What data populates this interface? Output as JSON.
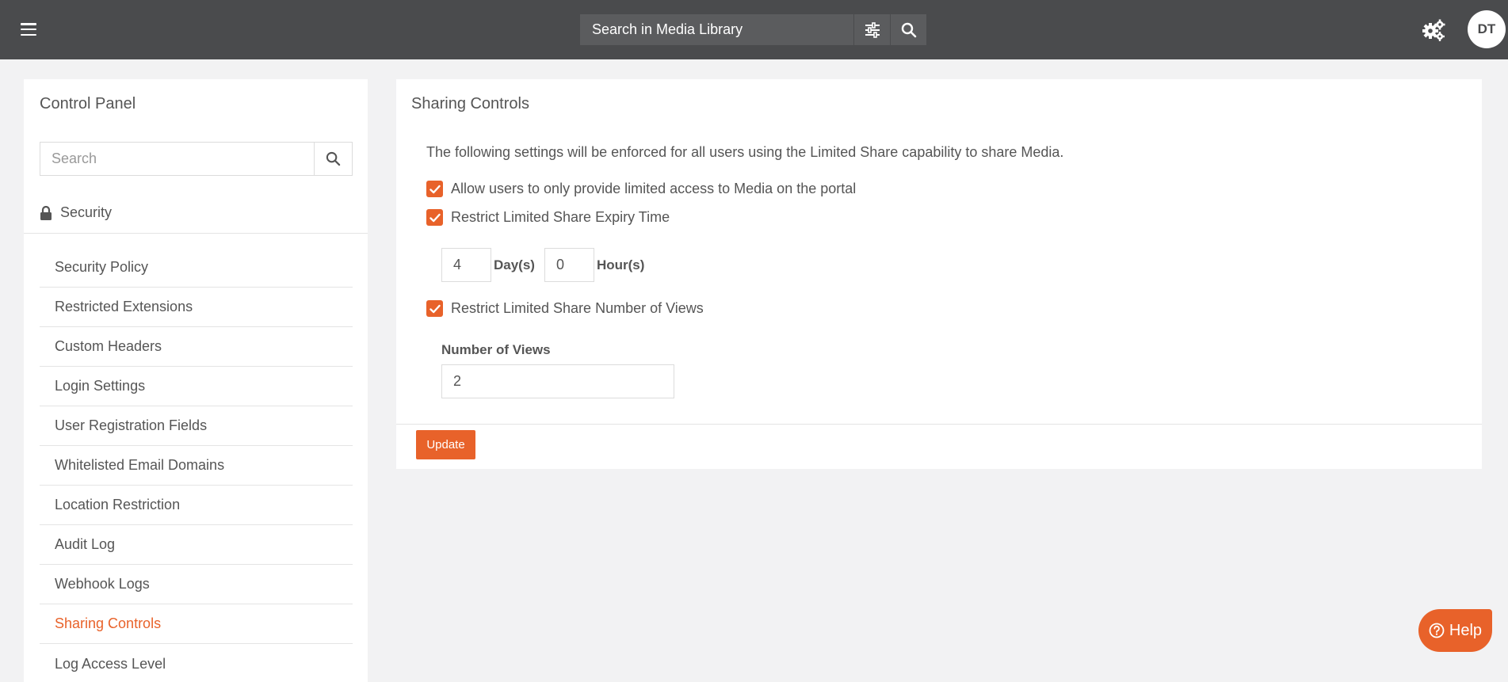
{
  "topbar": {
    "menu_icon": "hamburger-icon",
    "search_placeholder": "Search in Media Library",
    "filter_icon": "sliders-icon",
    "search_icon": "search-icon",
    "settings_icon": "gears-icon",
    "avatar_initials": "DT"
  },
  "sidebar": {
    "title": "Control Panel",
    "search_placeholder": "Search",
    "section": {
      "icon": "lock-icon",
      "label": "Security"
    },
    "items": [
      {
        "label": "Security Policy"
      },
      {
        "label": "Restricted Extensions"
      },
      {
        "label": "Custom Headers"
      },
      {
        "label": "Login Settings"
      },
      {
        "label": "User Registration Fields"
      },
      {
        "label": "Whitelisted Email Domains"
      },
      {
        "label": "Location Restriction"
      },
      {
        "label": "Audit Log"
      },
      {
        "label": "Webhook Logs"
      },
      {
        "label": "Sharing Controls",
        "active": true
      },
      {
        "label": "Log Access Level"
      }
    ]
  },
  "main": {
    "title": "Sharing Controls",
    "description": "The following settings will be enforced for all users using the Limited Share capability to share Media.",
    "options": [
      {
        "label": "Allow users to only provide limited access to Media on the portal",
        "checked": true
      },
      {
        "label": "Restrict Limited Share Expiry Time",
        "checked": true
      },
      {
        "label": "Restrict Limited Share Number of Views",
        "checked": true
      }
    ],
    "expiry": {
      "days_value": "4",
      "days_label": "Day(s)",
      "hours_value": "0",
      "hours_label": "Hour(s)"
    },
    "views": {
      "label": "Number of Views",
      "value": "2"
    },
    "update_label": "Update"
  },
  "help": {
    "label": "Help",
    "icon": "question-circle-icon"
  },
  "colors": {
    "accent": "#e8622a",
    "topbar": "#4a4b4d"
  }
}
